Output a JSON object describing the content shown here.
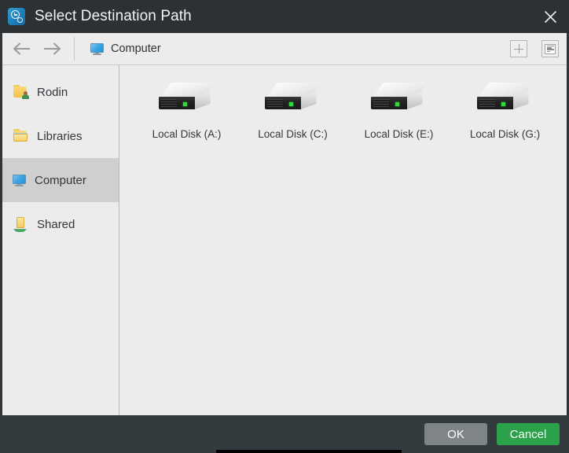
{
  "window": {
    "title": "Select Destination Path",
    "title_icon": "clock-gear-icon",
    "close_icon": "close-icon",
    "colors": {
      "titlebar_bg": "#2b3134",
      "chrome_bg": "#343b3e",
      "content_bg": "#ececec",
      "selected_row": "#cfcfcf",
      "accent_green": "#2ba14a",
      "ok_gray": "#7e8487"
    }
  },
  "toolbar": {
    "back_icon": "arrow-left-icon",
    "forward_icon": "arrow-right-icon",
    "location_icon": "computer-monitor-icon",
    "location_label": "Computer",
    "new_folder_icon": "plus-icon",
    "view_list_icon": "list-view-icon"
  },
  "sidebar": {
    "items": [
      {
        "label": "Rodin",
        "icon": "user-folder-icon",
        "selected": false
      },
      {
        "label": "Libraries",
        "icon": "libraries-folder-icon",
        "selected": false
      },
      {
        "label": "Computer",
        "icon": "computer-monitor-icon",
        "selected": true
      },
      {
        "label": "Shared",
        "icon": "shared-folder-icon",
        "selected": false
      }
    ]
  },
  "files": {
    "items": [
      {
        "label": "Local Disk (A:)",
        "icon": "hard-drive-icon"
      },
      {
        "label": "Local Disk (C:)",
        "icon": "hard-drive-icon"
      },
      {
        "label": "Local Disk (E:)",
        "icon": "hard-drive-icon"
      },
      {
        "label": "Local Disk (G:)",
        "icon": "hard-drive-icon"
      }
    ]
  },
  "footer": {
    "ok_label": "OK",
    "cancel_label": "Cancel"
  }
}
